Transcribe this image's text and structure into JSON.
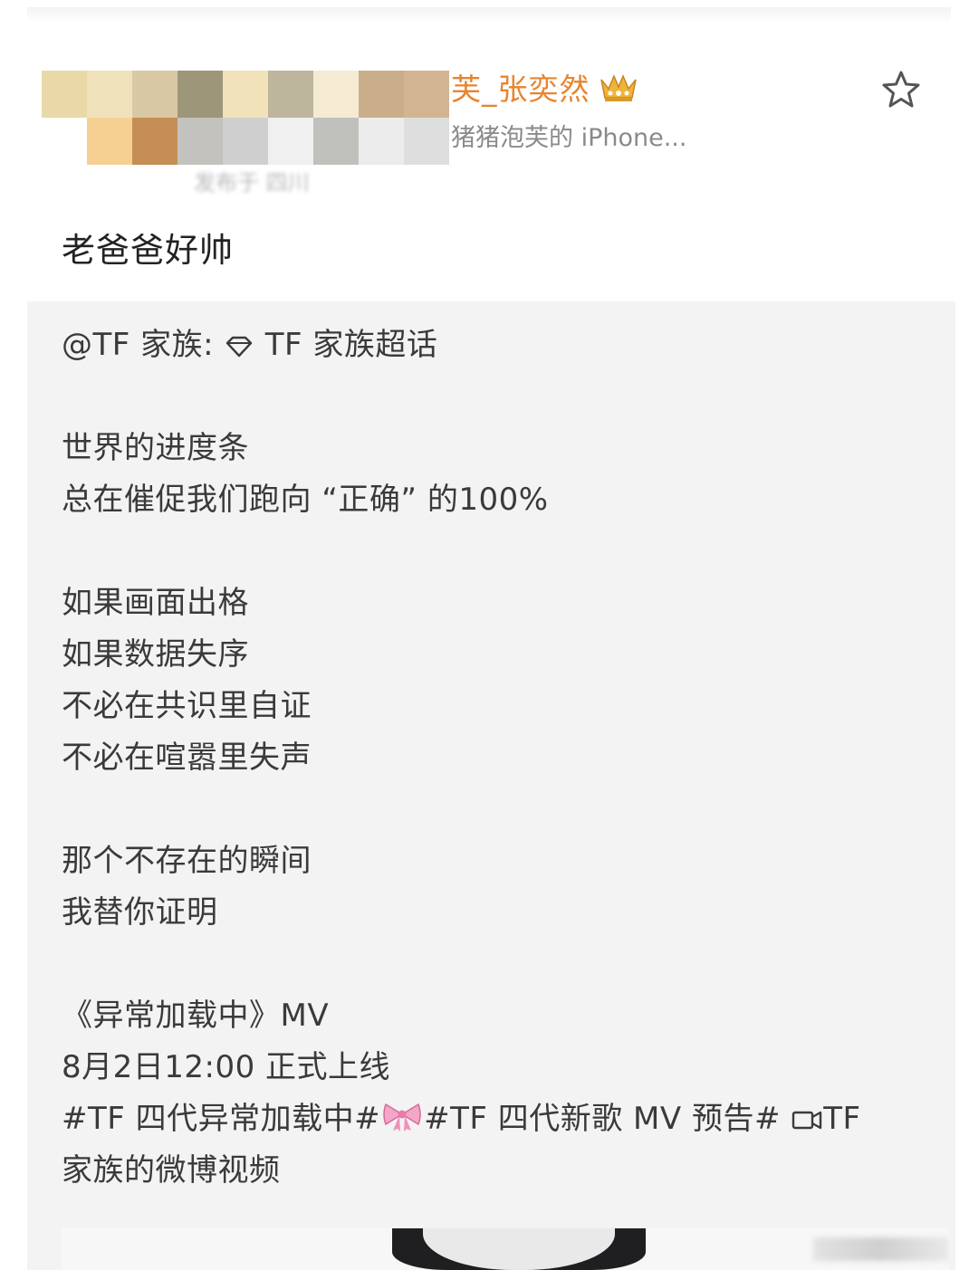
{
  "post": {
    "username": "芙_张奕然",
    "source": "猪猪泡芙的 iPhone...",
    "time": "发布于 四川",
    "caption": "老爸爸好帅",
    "favorite_icon": "star-outline-icon",
    "badge_icon": "crown-icon"
  },
  "repost": {
    "mention": "@TF 家族:",
    "super_topic_icon": "diamond-icon",
    "super_topic": "TF 家族超话",
    "lines1": [
      "世界的进度条",
      "总在催促我们跑向 “正确” 的100%"
    ],
    "lines2": [
      "如果画面出格",
      "如果数据失序",
      "不必在共识里自证",
      "不必在喧嚣里失声"
    ],
    "lines3": [
      "那个不存在的瞬间",
      "我替你证明"
    ],
    "mv_title": "《异常加载中》MV",
    "release": "8月2日12:00 正式上线",
    "hashtag1": "#TF 四代异常加载中#",
    "bow_icon": "ribbon-bow-icon",
    "hashtag2": "#TF 四代新歌 MV 预告#",
    "video_icon": "video-camera-icon",
    "video_link_a": "TF",
    "video_link_b": "家族的微博视频"
  },
  "colors": {
    "username": "#e8842e",
    "text": "#3a3a3a",
    "repost_bg": "#f3f3f4"
  }
}
